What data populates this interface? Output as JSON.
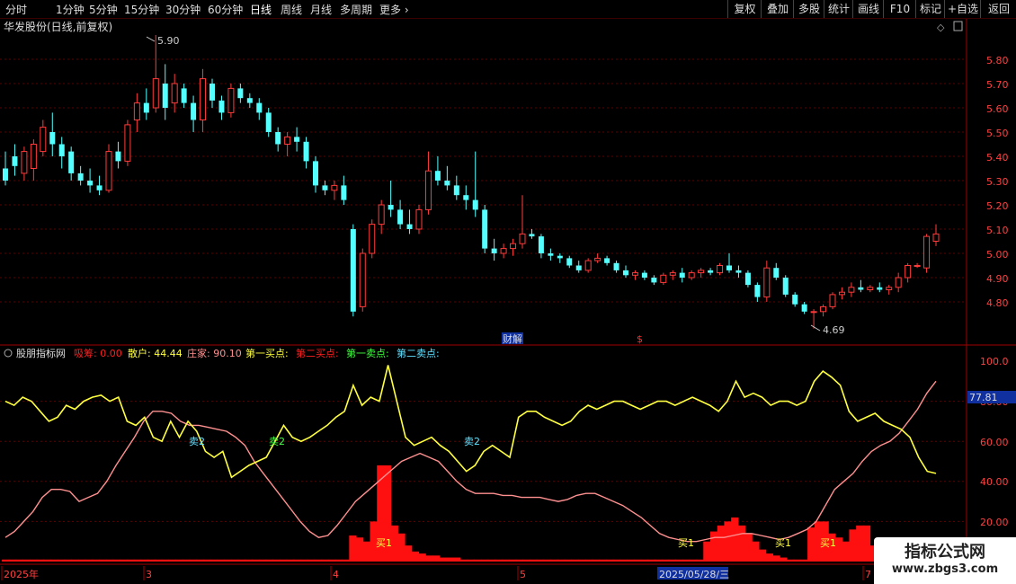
{
  "toolbar": {
    "periods": [
      "分时",
      "1分钟",
      "5分钟",
      "15分钟",
      "30分钟",
      "60分钟",
      "日线",
      "周线",
      "月线",
      "多周期",
      "更多"
    ],
    "active": "日线",
    "right": [
      "复权",
      "叠加",
      "多股",
      "统计",
      "画线",
      "F10",
      "标记",
      "+自选",
      "返回"
    ]
  },
  "main": {
    "title": "华发股份(日线,前复权)",
    "y_ticks": [
      "5.80",
      "5.70",
      "5.60",
      "5.50",
      "5.40",
      "5.30",
      "5.20",
      "5.10",
      "5.00",
      "4.90",
      "4.80"
    ],
    "high_label": "5.90",
    "low_label": "4.69",
    "event_labels": [
      "财解",
      "$"
    ]
  },
  "indicator": {
    "name": "股朋指标网",
    "legend": [
      {
        "label": "吸筹: ",
        "value": "0.00",
        "color": "#ff2020"
      },
      {
        "label": "散户: ",
        "value": "44.44",
        "color": "#ffff40"
      },
      {
        "label": "庄家: ",
        "value": "90.10",
        "color": "#ff9090"
      },
      {
        "label": "第一买点: ",
        "value": "",
        "color": "#ffff40"
      },
      {
        "label": "第二买点: ",
        "value": "",
        "color": "#ff2020"
      },
      {
        "label": "第一卖点: ",
        "value": "",
        "color": "#40ff40"
      },
      {
        "label": "第二卖点: ",
        "value": "",
        "color": "#60e0ff"
      }
    ],
    "y_ticks": [
      "100.0",
      "80.00",
      "60.00",
      "40.00",
      "20.00"
    ],
    "current_value": "77.81",
    "sell_labels": [
      "卖2",
      "卖2",
      "卖2"
    ],
    "buy_labels": [
      "买1",
      "买1",
      "买1",
      "买1"
    ]
  },
  "x_axis": {
    "labels": [
      "2025年",
      "3",
      "4",
      "5",
      "2025/05/28/三",
      "7"
    ]
  },
  "watermark": {
    "line1": "指标公式网",
    "line2": "www.zbgs3.com"
  },
  "chart_data": [
    {
      "type": "candlestick",
      "title": "华发股份(日线,前复权)",
      "ylim": [
        4.7,
        5.9
      ],
      "ohlc": [
        [
          5.35,
          5.42,
          5.28,
          5.3
        ],
        [
          5.4,
          5.45,
          5.32,
          5.36
        ],
        [
          5.33,
          5.44,
          5.3,
          5.42
        ],
        [
          5.35,
          5.47,
          5.3,
          5.45
        ],
        [
          5.42,
          5.55,
          5.4,
          5.52
        ],
        [
          5.5,
          5.58,
          5.4,
          5.45
        ],
        [
          5.45,
          5.48,
          5.35,
          5.4
        ],
        [
          5.42,
          5.44,
          5.3,
          5.33
        ],
        [
          5.33,
          5.36,
          5.28,
          5.3
        ],
        [
          5.3,
          5.35,
          5.25,
          5.28
        ],
        [
          5.28,
          5.32,
          5.24,
          5.26
        ],
        [
          5.26,
          5.45,
          5.25,
          5.42
        ],
        [
          5.42,
          5.46,
          5.35,
          5.38
        ],
        [
          5.38,
          5.55,
          5.36,
          5.53
        ],
        [
          5.55,
          5.66,
          5.5,
          5.62
        ],
        [
          5.62,
          5.68,
          5.55,
          5.58
        ],
        [
          5.6,
          5.9,
          5.58,
          5.72
        ],
        [
          5.7,
          5.78,
          5.55,
          5.6
        ],
        [
          5.62,
          5.74,
          5.58,
          5.7
        ],
        [
          5.68,
          5.7,
          5.6,
          5.62
        ],
        [
          5.62,
          5.65,
          5.5,
          5.55
        ],
        [
          5.55,
          5.76,
          5.5,
          5.72
        ],
        [
          5.7,
          5.72,
          5.6,
          5.63
        ],
        [
          5.63,
          5.65,
          5.55,
          5.58
        ],
        [
          5.58,
          5.7,
          5.56,
          5.68
        ],
        [
          5.68,
          5.7,
          5.62,
          5.64
        ],
        [
          5.64,
          5.66,
          5.6,
          5.62
        ],
        [
          5.62,
          5.64,
          5.55,
          5.58
        ],
        [
          5.58,
          5.6,
          5.48,
          5.5
        ],
        [
          5.5,
          5.52,
          5.42,
          5.45
        ],
        [
          5.45,
          5.5,
          5.4,
          5.48
        ],
        [
          5.48,
          5.52,
          5.42,
          5.46
        ],
        [
          5.46,
          5.48,
          5.35,
          5.38
        ],
        [
          5.38,
          5.4,
          5.25,
          5.28
        ],
        [
          5.28,
          5.3,
          5.24,
          5.26
        ],
        [
          5.26,
          5.3,
          5.22,
          5.28
        ],
        [
          5.28,
          5.32,
          5.2,
          5.22
        ],
        [
          5.1,
          5.12,
          4.74,
          4.76
        ],
        [
          4.78,
          5.02,
          4.76,
          5.0
        ],
        [
          5.0,
          5.14,
          4.98,
          5.12
        ],
        [
          5.12,
          5.22,
          5.08,
          5.2
        ],
        [
          5.2,
          5.3,
          5.15,
          5.18
        ],
        [
          5.18,
          5.22,
          5.1,
          5.12
        ],
        [
          5.12,
          5.18,
          5.08,
          5.1
        ],
        [
          5.1,
          5.2,
          5.08,
          5.18
        ],
        [
          5.18,
          5.42,
          5.16,
          5.34
        ],
        [
          5.34,
          5.4,
          5.28,
          5.3
        ],
        [
          5.3,
          5.36,
          5.26,
          5.28
        ],
        [
          5.28,
          5.32,
          5.22,
          5.24
        ],
        [
          5.24,
          5.28,
          5.18,
          5.22
        ],
        [
          5.22,
          5.42,
          5.15,
          5.18
        ],
        [
          5.18,
          5.2,
          5.0,
          5.02
        ],
        [
          5.02,
          5.06,
          4.97,
          5.0
        ],
        [
          5.0,
          5.04,
          4.98,
          5.02
        ],
        [
          5.02,
          5.06,
          4.99,
          5.04
        ],
        [
          5.04,
          5.24,
          5.02,
          5.08
        ],
        [
          5.08,
          5.1,
          5.06,
          5.07
        ],
        [
          5.07,
          5.08,
          4.98,
          5.0
        ],
        [
          5.0,
          5.02,
          4.97,
          4.99
        ],
        [
          4.99,
          5.0,
          4.96,
          4.98
        ],
        [
          4.98,
          4.99,
          4.94,
          4.95
        ],
        [
          4.95,
          4.97,
          4.92,
          4.93
        ],
        [
          4.93,
          4.98,
          4.92,
          4.97
        ],
        [
          4.97,
          5.0,
          4.96,
          4.98
        ],
        [
          4.98,
          4.99,
          4.95,
          4.96
        ],
        [
          4.96,
          4.97,
          4.92,
          4.93
        ],
        [
          4.93,
          4.95,
          4.9,
          4.91
        ],
        [
          4.91,
          4.93,
          4.89,
          4.92
        ],
        [
          4.92,
          4.93,
          4.89,
          4.9
        ],
        [
          4.9,
          4.91,
          4.87,
          4.88
        ],
        [
          4.88,
          4.92,
          4.87,
          4.91
        ],
        [
          4.91,
          4.93,
          4.89,
          4.92
        ],
        [
          4.92,
          4.94,
          4.88,
          4.9
        ],
        [
          4.9,
          4.93,
          4.89,
          4.92
        ],
        [
          4.92,
          4.94,
          4.9,
          4.93
        ],
        [
          4.93,
          4.94,
          4.91,
          4.92
        ],
        [
          4.92,
          4.96,
          4.91,
          4.95
        ],
        [
          4.95,
          5.0,
          4.92,
          4.93
        ],
        [
          4.93,
          4.95,
          4.9,
          4.92
        ],
        [
          4.92,
          4.93,
          4.86,
          4.87
        ],
        [
          4.87,
          4.88,
          4.8,
          4.82
        ],
        [
          4.82,
          4.97,
          4.8,
          4.94
        ],
        [
          4.94,
          4.96,
          4.89,
          4.9
        ],
        [
          4.9,
          4.91,
          4.82,
          4.83
        ],
        [
          4.83,
          4.84,
          4.78,
          4.79
        ],
        [
          4.79,
          4.8,
          4.75,
          4.76
        ],
        [
          4.76,
          4.77,
          4.69,
          4.76
        ],
        [
          4.76,
          4.79,
          4.74,
          4.78
        ],
        [
          4.78,
          4.84,
          4.77,
          4.83
        ],
        [
          4.83,
          4.86,
          4.81,
          4.84
        ],
        [
          4.84,
          4.88,
          4.82,
          4.86
        ],
        [
          4.86,
          4.89,
          4.84,
          4.85
        ],
        [
          4.85,
          4.87,
          4.84,
          4.86
        ],
        [
          4.86,
          4.88,
          4.84,
          4.85
        ],
        [
          4.85,
          4.87,
          4.83,
          4.86
        ],
        [
          4.86,
          4.92,
          4.84,
          4.9
        ],
        [
          4.9,
          4.96,
          4.88,
          4.95
        ],
        [
          4.95,
          4.96,
          4.94,
          4.95
        ],
        [
          4.94,
          5.08,
          4.92,
          5.07
        ],
        [
          5.05,
          5.12,
          5.03,
          5.08
        ]
      ]
    },
    {
      "type": "line",
      "title": "股朋指标网",
      "ylim": [
        0,
        100
      ],
      "series": [
        {
          "name": "散户",
          "color": "#ffff40",
          "values": [
            80,
            78,
            82,
            80,
            75,
            70,
            72,
            78,
            76,
            80,
            82,
            83,
            80,
            82,
            70,
            68,
            72,
            62,
            60,
            70,
            62,
            70,
            65,
            55,
            52,
            55,
            42,
            45,
            48,
            50,
            52,
            60,
            68,
            62,
            60,
            62,
            65,
            68,
            72,
            75,
            88,
            78,
            82,
            80,
            98,
            80,
            62,
            58,
            60,
            62,
            58,
            55,
            50,
            45,
            48,
            55,
            58,
            55,
            52,
            72,
            75,
            75,
            72,
            70,
            68,
            70,
            75,
            78,
            76,
            78,
            80,
            80,
            78,
            76,
            78,
            80,
            80,
            78,
            80,
            82,
            80,
            78,
            75,
            80,
            90,
            82,
            84,
            82,
            78,
            80,
            80,
            78,
            80,
            90,
            95,
            92,
            88,
            75,
            70,
            72,
            74,
            70,
            68,
            66,
            62,
            52,
            45,
            44
          ]
        },
        {
          "name": "庄家",
          "color": "#ff9090",
          "values": [
            12,
            15,
            20,
            25,
            32,
            36,
            36,
            35,
            30,
            32,
            34,
            40,
            48,
            55,
            62,
            70,
            75,
            75,
            74,
            70,
            68,
            68,
            67,
            66,
            65,
            62,
            58,
            50,
            44,
            38,
            32,
            26,
            20,
            15,
            12,
            13,
            18,
            24,
            30,
            34,
            38,
            42,
            46,
            50,
            52,
            54,
            52,
            50,
            45,
            40,
            36,
            34,
            34,
            34,
            33,
            33,
            32,
            32,
            32,
            31,
            30,
            31,
            33,
            34,
            34,
            32,
            30,
            28,
            25,
            22,
            18,
            14,
            12,
            11,
            10,
            10,
            11,
            12,
            12,
            13,
            14,
            14,
            13,
            12,
            11,
            12,
            14,
            16,
            20,
            28,
            36,
            40,
            44,
            50,
            55,
            58,
            60,
            64,
            70,
            76,
            84,
            90
          ]
        },
        {
          "name": "吸筹",
          "color": "#ff2020",
          "type": "bar",
          "values": [
            1,
            1,
            1,
            1,
            1,
            1,
            1,
            1,
            1,
            1,
            1,
            1,
            1,
            1,
            1,
            1,
            1,
            1,
            1,
            1,
            1,
            1,
            1,
            1,
            1,
            1,
            1,
            1,
            1,
            1,
            1,
            1,
            1,
            1,
            1,
            1,
            1,
            1,
            1,
            1,
            1,
            1,
            1,
            1,
            1,
            1,
            1,
            1,
            1,
            1,
            13,
            12,
            10,
            20,
            48,
            48,
            18,
            14,
            8,
            5,
            4,
            3,
            3,
            2,
            2,
            2,
            1,
            1,
            1,
            1,
            1,
            1,
            1,
            1,
            1,
            1,
            1,
            1,
            1,
            1,
            1,
            1,
            1,
            1,
            1,
            1,
            1,
            1,
            1,
            1,
            1,
            1,
            1,
            1,
            1,
            1,
            1,
            1,
            1,
            1,
            1,
            10,
            15,
            18,
            20,
            22,
            18,
            14,
            10,
            6,
            4,
            3,
            2,
            1,
            1,
            1,
            17,
            20,
            20,
            14,
            12,
            10,
            16,
            18,
            18,
            8,
            5,
            4,
            3,
            2,
            2,
            1,
            1,
            1,
            1
          ]
        }
      ]
    }
  ]
}
